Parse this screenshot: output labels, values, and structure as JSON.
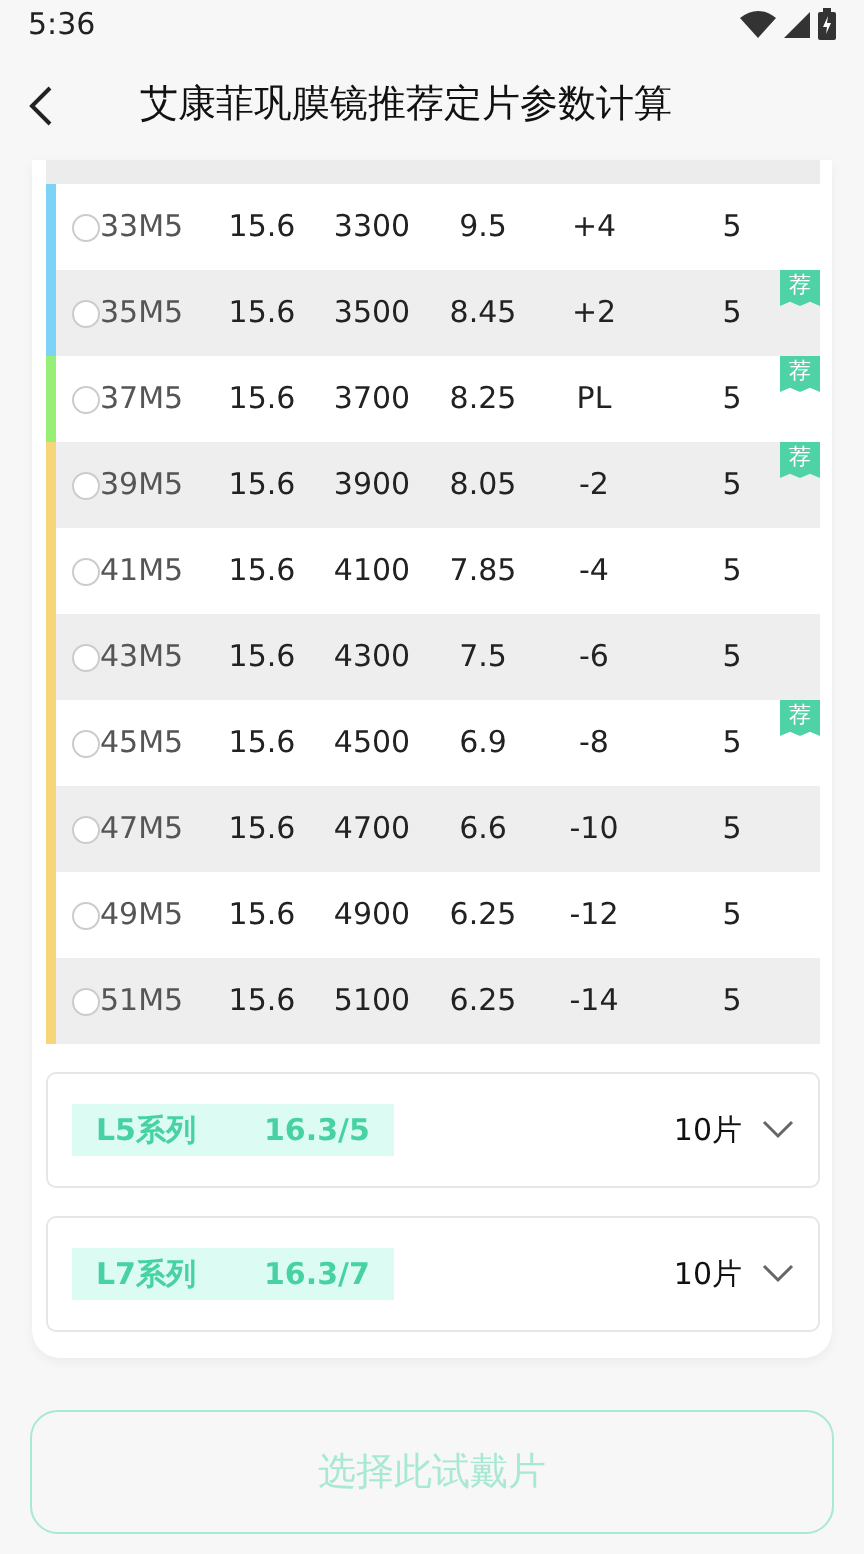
{
  "status_bar": {
    "time": "5:36"
  },
  "header": {
    "title": "艾康菲巩膜镜推荐定片参数计算"
  },
  "rows": [
    {
      "name": "33M5",
      "col_2": "15.6",
      "col_3": "3300",
      "col_4": "9.5",
      "col_5": "+4",
      "col_6": "5",
      "color": "#7dd3f5",
      "selected": false
    },
    {
      "name": "35M5",
      "col_2": "15.6",
      "col_3": "3500",
      "col_4": "8.45",
      "col_5": "+2",
      "col_6": "5",
      "color": "#7dd3f5",
      "badge": "荐",
      "selected": false
    },
    {
      "name": "37M5",
      "col_2": "15.6",
      "col_3": "3700",
      "col_4": "8.25",
      "col_5": "PL",
      "col_6": "5",
      "color": "#97ef78",
      "badge": "荐",
      "selected": false
    },
    {
      "name": "39M5",
      "col_2": "15.6",
      "col_3": "3900",
      "col_4": "8.05",
      "col_5": "-2",
      "col_6": "5",
      "color": "#f7d67a",
      "badge": "荐",
      "selected": false
    },
    {
      "name": "41M5",
      "col_2": "15.6",
      "col_3": "4100",
      "col_4": "7.85",
      "col_5": "-4",
      "col_6": "5",
      "color": "#f7d67a",
      "selected": false
    },
    {
      "name": "43M5",
      "col_2": "15.6",
      "col_3": "4300",
      "col_4": "7.5",
      "col_5": "-6",
      "col_6": "5",
      "color": "#f7d67a",
      "selected": false
    },
    {
      "name": "45M5",
      "col_2": "15.6",
      "col_3": "4500",
      "col_4": "6.9",
      "col_5": "-8",
      "col_6": "5",
      "color": "#f7d67a",
      "badge": "荐",
      "selected": false
    },
    {
      "name": "47M5",
      "col_2": "15.6",
      "col_3": "4700",
      "col_4": "6.6",
      "col_5": "-10",
      "col_6": "5",
      "color": "#f7d67a",
      "selected": false
    },
    {
      "name": "49M5",
      "col_2": "15.6",
      "col_3": "4900",
      "col_4": "6.25",
      "col_5": "-12",
      "col_6": "5",
      "color": "#f7d67a",
      "selected": false
    },
    {
      "name": "51M5",
      "col_2": "15.6",
      "col_3": "5100",
      "col_4": "6.25",
      "col_5": "-14",
      "col_6": "5",
      "color": "#f7d67a",
      "selected": false
    }
  ],
  "series": [
    {
      "name": "L5系列",
      "spec": "16.3/5",
      "count": "10片",
      "expanded": false
    },
    {
      "name": "L7系列",
      "spec": "16.3/7",
      "count": "10片",
      "expanded": false
    }
  ],
  "button": {
    "label": "选择此试戴片",
    "disabled": true
  }
}
